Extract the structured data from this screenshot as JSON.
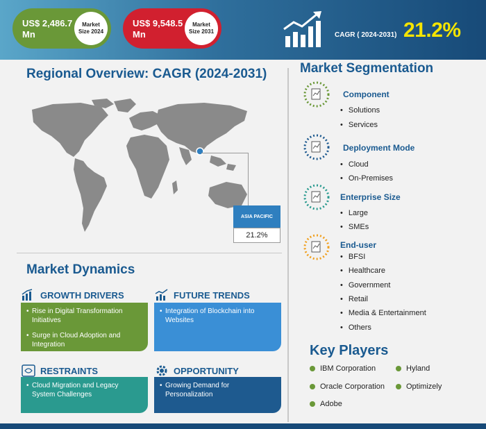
{
  "header": {
    "market_2024": {
      "value": "US$  2,486.7\nMn",
      "value_line1": "US$  2,486.7",
      "value_line2": "Mn",
      "label": "Market Size 2024"
    },
    "market_2031": {
      "value_line1": "US$  9,548.5",
      "value_line2": "Mn",
      "label": "Market Size 2031"
    },
    "cagr_label": "CAGR ( 2024-2031)",
    "cagr_value": "21.2%"
  },
  "regional": {
    "title": "Regional Overview: CAGR (2024-2031)",
    "highlight_region": "ASIA PACIFIC",
    "highlight_value": "21.2%"
  },
  "dynamics": {
    "title": "Market Dynamics",
    "growth_drivers": {
      "title": "GROWTH DRIVERS",
      "items": [
        "Rise in Digital Transformation Initiatives",
        "Surge in Cloud Adoption and Integration"
      ]
    },
    "future_trends": {
      "title": "FUTURE TRENDS",
      "items": [
        "Integration of Blockchain into Websites"
      ]
    },
    "restraints": {
      "title": "RESTRAINTS",
      "items": [
        "Cloud Migration and Legacy System Challenges"
      ]
    },
    "opportunity": {
      "title": "OPPORTUNITY",
      "items": [
        "Growing Demand for Personalization"
      ]
    }
  },
  "segmentation": {
    "title": "Market Segmentation",
    "groups": [
      {
        "title": "Component",
        "items": [
          "Solutions",
          "Services"
        ],
        "color": "#6a9838"
      },
      {
        "title": "Deployment Mode",
        "items": [
          "Cloud",
          "On-Premises"
        ],
        "color": "#1e5a8f"
      },
      {
        "title": "Enterprise Size",
        "items": [
          "Large",
          "SMEs"
        ],
        "color": "#2a9a8f"
      },
      {
        "title": "End-user",
        "items": [
          "BFSI",
          "Healthcare",
          "Government",
          "Retail",
          "Media & Entertainment",
          "Others"
        ],
        "color": "#f0a020"
      }
    ]
  },
  "key_players": {
    "title": "Key Players",
    "players": [
      "IBM Corporation",
      "Oracle Corporation",
      "Adobe",
      "Hyland",
      "Optimizely"
    ]
  },
  "colors": {
    "green": "#6a9838",
    "red": "#d1202f",
    "yellow": "#f4e400",
    "navy": "#174a78",
    "blue": "#3a8fd6",
    "teal": "#2a9a8f"
  }
}
